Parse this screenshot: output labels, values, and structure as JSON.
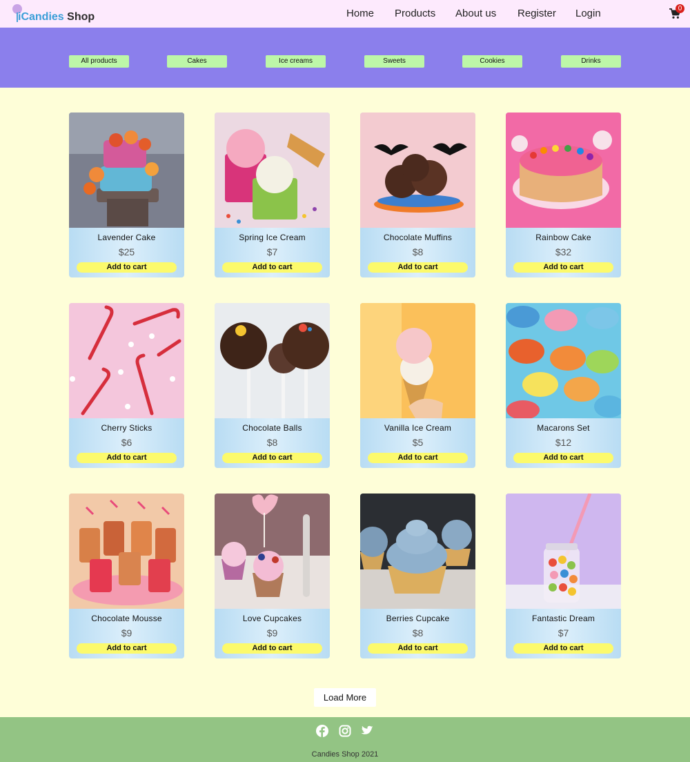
{
  "brand": {
    "part1": "iCandies",
    "part2": "Shop"
  },
  "nav": [
    "Home",
    "Products",
    "About us",
    "Register",
    "Login"
  ],
  "cart": {
    "icon": "cart-icon",
    "count": "0"
  },
  "categories": [
    "All products",
    "Cakes",
    "Ice creams",
    "Sweets",
    "Cookies",
    "Drinks"
  ],
  "products": [
    {
      "name": "Lavender Cake",
      "price": "$25",
      "button": "Add to cart"
    },
    {
      "name": "Spring Ice Cream",
      "price": "$7",
      "button": "Add to cart"
    },
    {
      "name": "Chocolate Muffins",
      "price": "$8",
      "button": "Add to cart"
    },
    {
      "name": "Rainbow Cake",
      "price": "$32",
      "button": "Add to cart"
    },
    {
      "name": "Cherry Sticks",
      "price": "$6",
      "button": "Add to cart"
    },
    {
      "name": "Chocolate Balls",
      "price": "$8",
      "button": "Add to cart"
    },
    {
      "name": "Vanilla Ice Cream",
      "price": "$5",
      "button": "Add to cart"
    },
    {
      "name": "Macarons Set",
      "price": "$12",
      "button": "Add to cart"
    },
    {
      "name": "Chocolate Mousse",
      "price": "$9",
      "button": "Add to cart"
    },
    {
      "name": "Love Cupcakes",
      "price": "$9",
      "button": "Add to cart"
    },
    {
      "name": "Berries Cupcake",
      "price": "$8",
      "button": "Add to cart"
    },
    {
      "name": "Fantastic Dream",
      "price": "$7",
      "button": "Add to cart"
    }
  ],
  "load_more": "Load More",
  "footer": {
    "social": [
      "facebook-icon",
      "instagram-icon",
      "twitter-icon"
    ],
    "copyright": "Candies Shop 2021"
  },
  "colors": {
    "header_bg": "#fdeafd",
    "band_bg": "#8b7fec",
    "category_button": "#bdf7a8",
    "page_bg": "#fefed8",
    "cart_button": "#fcfa6c",
    "footer_bg": "#93c484",
    "badge": "#d9201d"
  }
}
